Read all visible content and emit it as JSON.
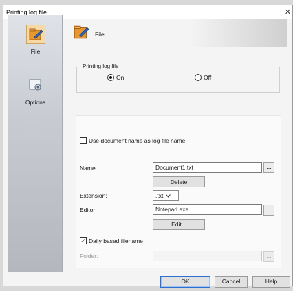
{
  "window": {
    "title": "Printing log file"
  },
  "sidebar": {
    "items": [
      {
        "label": "File",
        "icon": "file-pencil-icon",
        "active": true
      },
      {
        "label": "Options",
        "icon": "options-icon",
        "active": false
      }
    ]
  },
  "header": {
    "title": "File",
    "icon": "file-pencil-icon"
  },
  "log_group": {
    "label": "Printing log file",
    "on_label": "On",
    "off_label": "Off",
    "selected": "On"
  },
  "settings": {
    "use_doc_name_label": "Use document name as log file name",
    "use_doc_name_checked": false,
    "name_label": "Name",
    "name_value": "Document1.txt",
    "browse_label": "...",
    "delete_label": "Delete",
    "extension_label": "Extension:",
    "extension_value": ".txt",
    "editor_label": "Editor",
    "editor_value": "Notepad.exe",
    "edit_label": "Edit...",
    "daily_label": "Daily based filename",
    "daily_checked": true,
    "folder_label": "Folder:",
    "folder_value": ""
  },
  "footer": {
    "ok_label": "OK",
    "cancel_label": "Cancel",
    "help_label": "Help"
  },
  "colors": {
    "accent": "#2b6fd0",
    "active_item": "#f7d9a6",
    "icon_orange": "#e8962e"
  }
}
